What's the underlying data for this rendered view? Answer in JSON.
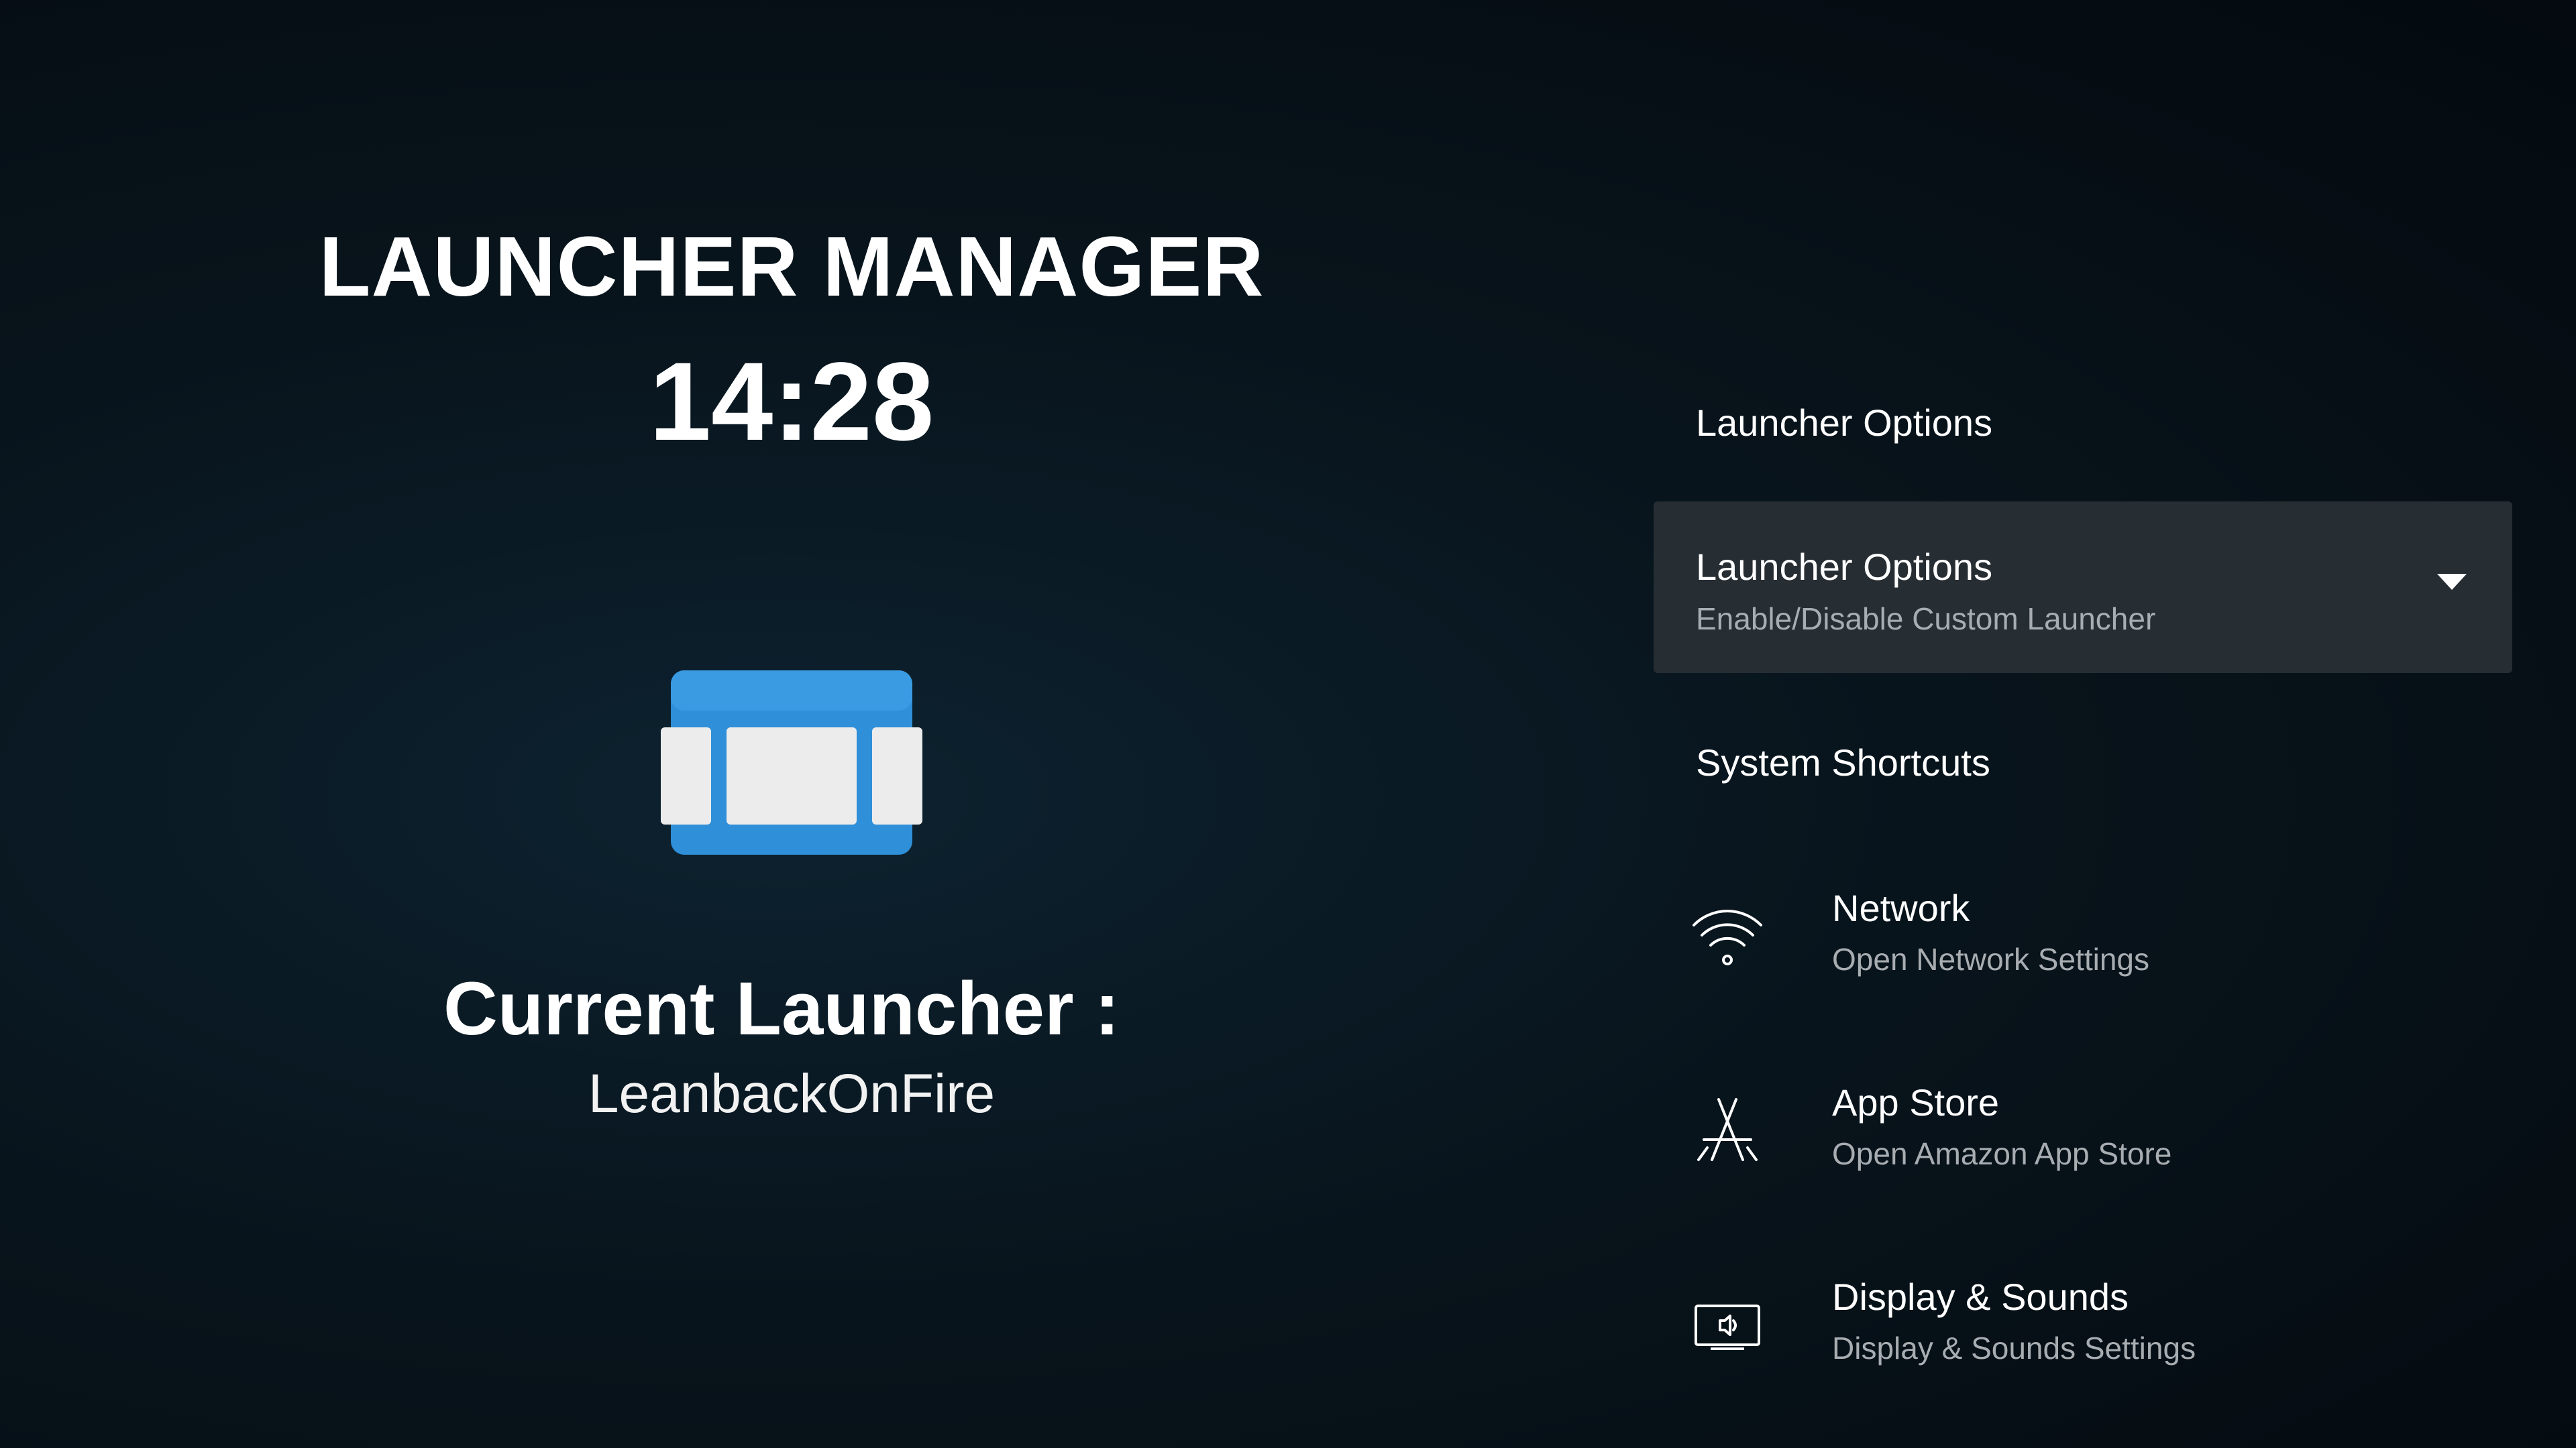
{
  "app": {
    "title": "LAUNCHER MANAGER",
    "clock": "14:28",
    "current_launcher_label": "Current Launcher :",
    "current_launcher_value": "LeanbackOnFire",
    "icon": "launcher-cards-icon"
  },
  "menu": {
    "launcher_section_header": "Launcher Options",
    "launcher_options": {
      "title": "Launcher Options",
      "subtitle": "Enable/Disable Custom Launcher",
      "icon": "chevron-down-icon"
    },
    "shortcuts_section_header": "System Shortcuts",
    "shortcuts": [
      {
        "title": "Network",
        "subtitle": "Open Network Settings",
        "icon": "wifi-icon"
      },
      {
        "title": "App Store",
        "subtitle": "Open Amazon App Store",
        "icon": "app-store-icon"
      },
      {
        "title": "Display & Sounds",
        "subtitle": "Display & Sounds Settings",
        "icon": "display-sound-icon"
      }
    ]
  },
  "colors": {
    "background": "#08141c",
    "selected_row": "#262d33",
    "icon_blue": "#2f8fd8",
    "subtitle_text": "#a8adb1"
  }
}
